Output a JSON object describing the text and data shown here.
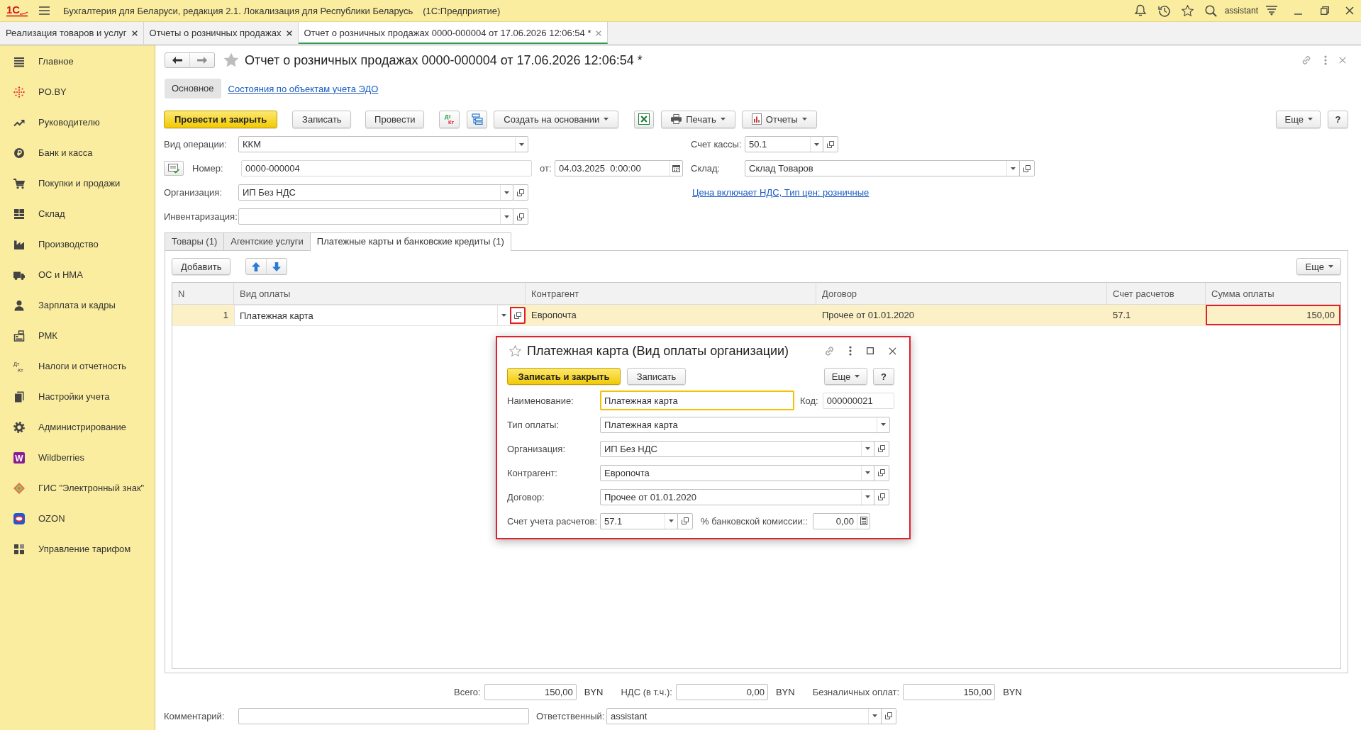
{
  "app_bar": {
    "logo": "1С",
    "title": "Бухгалтерия для Беларуси, редакция 2.1. Локализация для Республики Беларусь",
    "platform": "(1С:Предприятие)",
    "user": "assistant"
  },
  "open_tabs": [
    {
      "label": "Реализация товаров и услуг",
      "selected": false
    },
    {
      "label": "Отчеты о розничных продажах",
      "selected": false
    },
    {
      "label": "Отчет о розничных продажах 0000-000004 от 17.06.2026 12:06:54 *",
      "selected": true
    }
  ],
  "sidebar": {
    "items": [
      {
        "label": "Главное"
      },
      {
        "label": "PO.BY"
      },
      {
        "label": "Руководителю"
      },
      {
        "label": "Банк и касса"
      },
      {
        "label": "Покупки и продажи"
      },
      {
        "label": "Склад"
      },
      {
        "label": "Производство"
      },
      {
        "label": "ОС и НМА"
      },
      {
        "label": "Зарплата и кадры"
      },
      {
        "label": "РМК"
      },
      {
        "label": "Налоги и отчетность",
        "icon_text": [
          "Дт",
          "Кт"
        ]
      },
      {
        "label": "Настройки учета"
      },
      {
        "label": "Администрирование"
      },
      {
        "label": "Wildberries",
        "icon_text": [
          "W"
        ]
      },
      {
        "label": "ГИС \"Электронный знак\""
      },
      {
        "label": "OZON"
      },
      {
        "label": "Управление тарифом"
      }
    ]
  },
  "document": {
    "title": "Отчет о розничных продажах 0000-000004 от 17.06.2026 12:06:54 *",
    "sections": [
      {
        "label": "Основное",
        "selected": true
      },
      {
        "label": "Состояния по объектам учета ЭДО",
        "selected": false
      }
    ],
    "toolbar": {
      "post_and_close": "Провести и закрыть",
      "save": "Записать",
      "post": "Провести",
      "entries_icon": [
        "Дт",
        "Кт"
      ],
      "create_based_on": "Создать на основании",
      "print": "Печать",
      "reports": "Отчеты",
      "more": "Еще",
      "help": "?"
    },
    "fields": {
      "operation_type": {
        "label": "Вид операции:",
        "value": "ККМ"
      },
      "cash_account": {
        "label": "Счет кассы:",
        "value": "50.1"
      },
      "number": {
        "label": "Номер:",
        "value": "0000-000004"
      },
      "date": {
        "label": "от:",
        "value": "04.03.2025  0:00:00"
      },
      "warehouse": {
        "label": "Склад:",
        "value": "Склад Товаров"
      },
      "organization": {
        "label": "Организация:",
        "value": "ИП Без НДС"
      },
      "price_link": "Цена включает НДС, Тип цен: розничные",
      "inventory": {
        "label": "Инвентаризация:"
      }
    },
    "tabs": [
      {
        "label": "Товары (1)",
        "selected": false
      },
      {
        "label": "Агентские услуги",
        "selected": false
      },
      {
        "label": "Платежные карты и банковские кредиты (1)",
        "selected": true
      }
    ],
    "table_toolbar": {
      "add": "Добавить",
      "more": "Еще"
    },
    "table": {
      "columns": [
        "N",
        "Вид оплаты",
        "Контрагент",
        "Договор",
        "Счет расчетов",
        "Сумма оплаты"
      ],
      "rows": [
        {
          "selected": true,
          "cells": [
            {
              "kind": "number",
              "text": "1",
              "highlighted": false
            },
            {
              "kind": "select",
              "text": "Платежная карта",
              "highlighted": false,
              "open_highlighted": true
            },
            {
              "kind": "text",
              "text": "Европочта",
              "highlighted": false
            },
            {
              "kind": "text",
              "text": "Прочее от 01.01.2020",
              "highlighted": false
            },
            {
              "kind": "text",
              "text": "57.1",
              "highlighted": false
            },
            {
              "kind": "number",
              "text": "150,00",
              "highlighted": true
            }
          ]
        }
      ]
    },
    "totals": [
      {
        "label": "Всего:",
        "value": "150,00",
        "currency": "BYN"
      },
      {
        "label": "НДС (в т.ч.):",
        "value": "0,00",
        "currency": "BYN"
      },
      {
        "label": "Безналичных оплат:",
        "value": "150,00",
        "currency": "BYN"
      }
    ],
    "comment": {
      "label": "Комментарий:"
    },
    "responsible": {
      "label": "Ответственный:",
      "value": "assistant"
    }
  },
  "dialog": {
    "title": "Платежная карта (Вид оплаты организации)",
    "highlighted": true,
    "buttons": {
      "save_and_close": "Записать и закрыть",
      "save": "Записать",
      "more": "Еще",
      "help": "?"
    },
    "name": {
      "label": "Наименование:",
      "value": "Платежная карта",
      "focused": true
    },
    "code": {
      "label": "Код:",
      "value": "000000021"
    },
    "payment_type": {
      "label": "Тип оплаты:",
      "value": "Платежная карта"
    },
    "organization": {
      "label": "Организация:",
      "value": "ИП Без НДС"
    },
    "counterparty": {
      "label": "Контрагент:",
      "value": "Европочта"
    },
    "contract": {
      "label": "Договор:",
      "value": "Прочее от 01.01.2020"
    },
    "settlement_account": {
      "label": "Счет учета расчетов:",
      "value": "57.1"
    },
    "bank_commission": {
      "label": "% банковской комиссии::",
      "value": "0,00"
    }
  }
}
